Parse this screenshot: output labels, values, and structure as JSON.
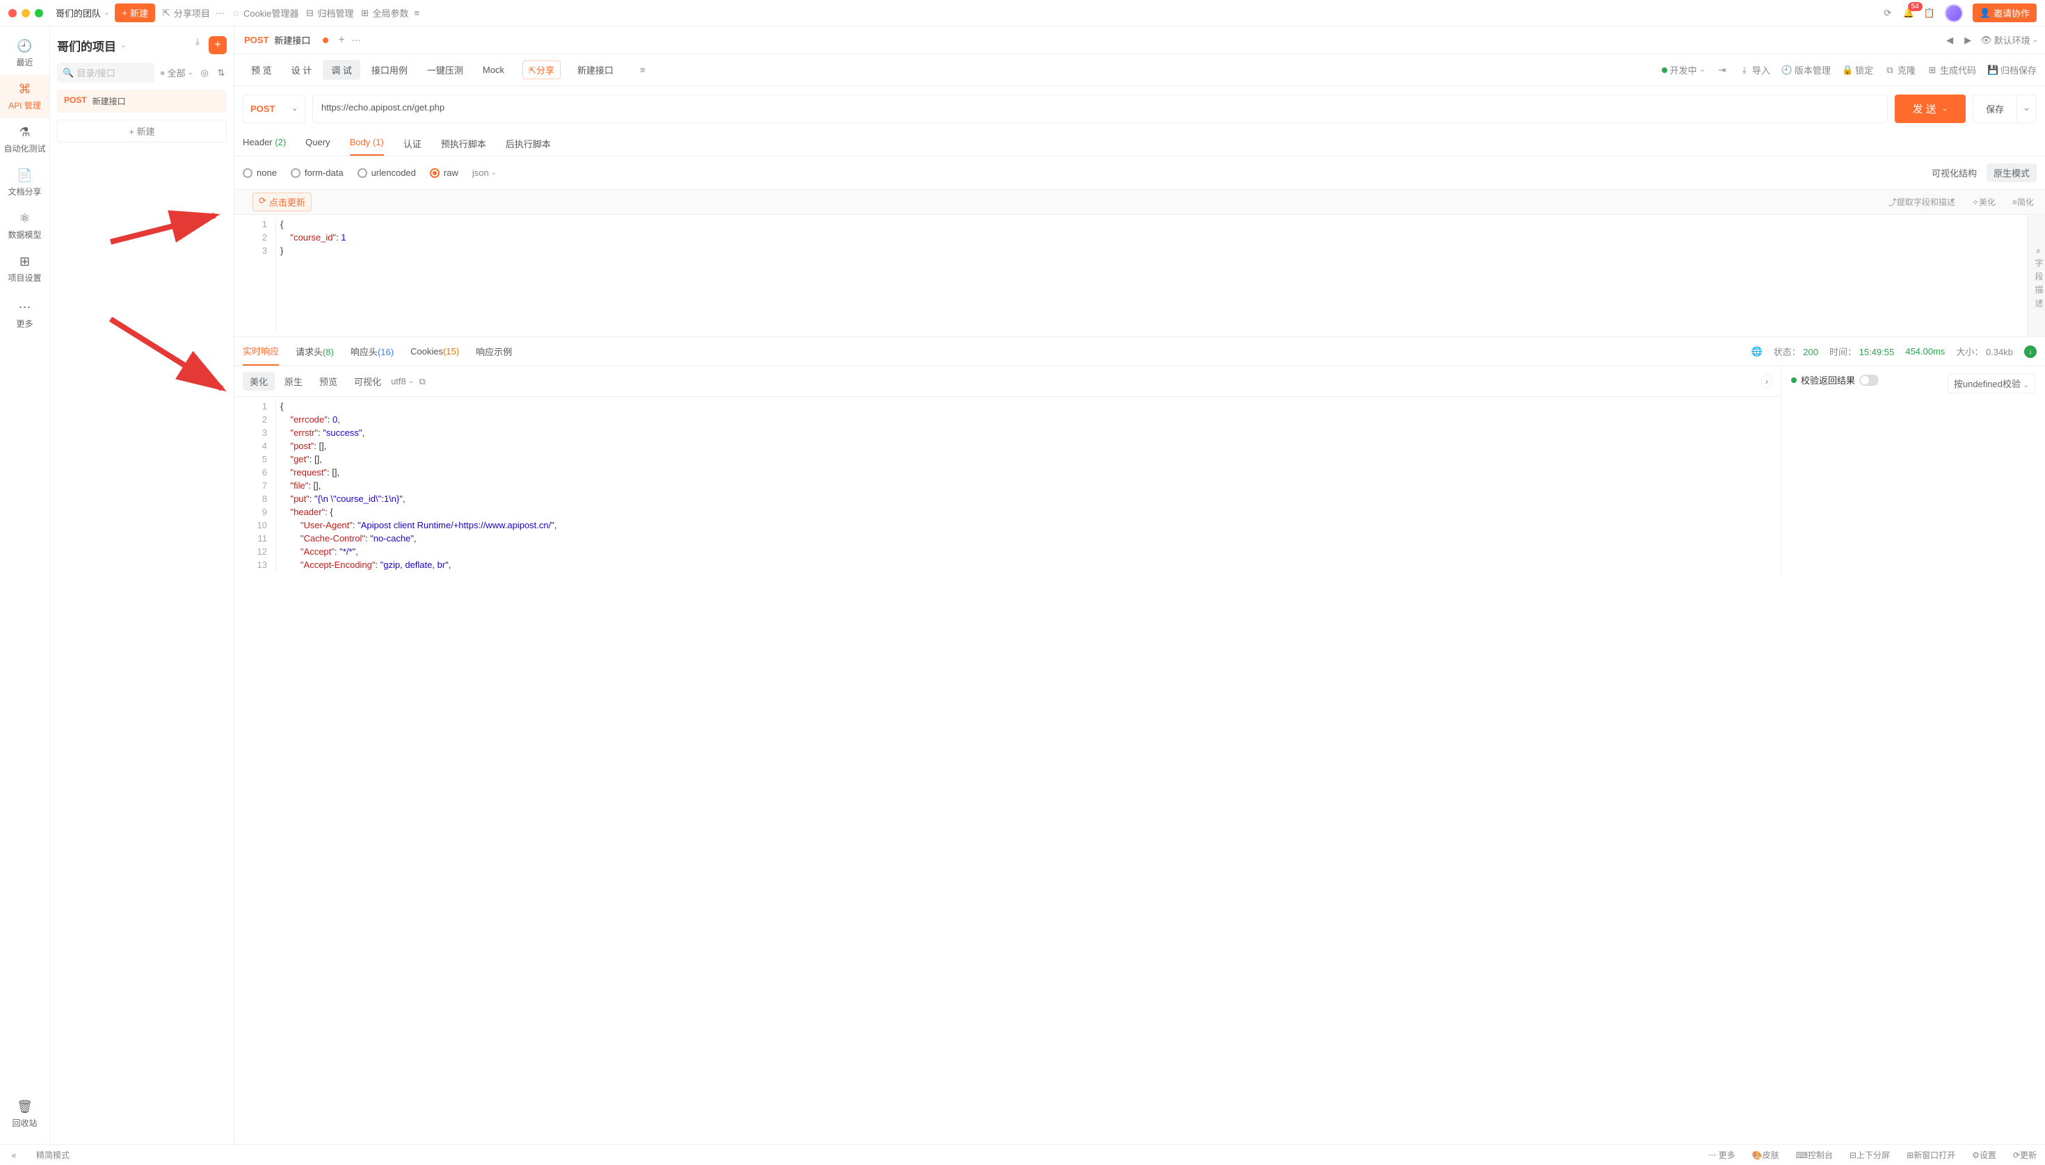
{
  "titlebar": {
    "team": "哥们的团队",
    "new": "新建",
    "share": "分享项目",
    "cookie": "Cookie管理器",
    "archive": "归档管理",
    "globals": "全局参数",
    "badge": "54",
    "invite": "邀请协作"
  },
  "rail": {
    "recent": "最近",
    "api": "API 管理",
    "autotest": "自动化测试",
    "docs": "文档分享",
    "models": "数据模型",
    "settings": "项目设置",
    "more": "更多",
    "trash": "回收站"
  },
  "sidebar": {
    "project": "哥们的项目",
    "search_ph": "目录/接口",
    "filter_all": "全部",
    "tree_method": "POST",
    "tree_name": "新建接口",
    "new_btn": "新建"
  },
  "tabs": {
    "method": "POST",
    "title": "新建接口",
    "env": "默认环境"
  },
  "toolbar": {
    "preview": "预 览",
    "design": "设 计",
    "debug": "调 试",
    "usecase": "接口用例",
    "stress": "一键压测",
    "mock": "Mock",
    "share": "分享",
    "api_name": "新建接口",
    "status": "开发中",
    "import": "导入",
    "version": "版本管理",
    "lock": "锁定",
    "clone": "克隆",
    "gencode": "生成代码",
    "archive": "归档保存"
  },
  "url": {
    "method": "POST",
    "value": "https://echo.apipost.cn/get.php",
    "send": "发 送",
    "save": "保存"
  },
  "reqtabs": {
    "header": "Header",
    "header_cnt": "(2)",
    "query": "Query",
    "body": "Body",
    "body_cnt": "(1)",
    "auth": "认证",
    "pre": "预执行脚本",
    "post": "后执行脚本"
  },
  "bodytypes": {
    "none": "none",
    "form": "form-data",
    "urlenc": "urlencoded",
    "raw": "raw",
    "json": "json",
    "visual": "可视化结构",
    "rawmode": "原生模式"
  },
  "editorhead": {
    "refresh": "点击更新",
    "extract": "提取字段和描述",
    "beautify": "美化",
    "simplify": "简化"
  },
  "reqbody": {
    "l1": "{",
    "l2key": "\"course_id\"",
    "l2val": "1",
    "l3": "}"
  },
  "sidepanel": "« 字 段 描 述",
  "resptabs": {
    "live": "实时响应",
    "reqh": "请求头",
    "reqh_cnt": "(8)",
    "resph": "响应头",
    "resph_cnt": "(16)",
    "cookies": "Cookies",
    "cookies_cnt": "(15)",
    "example": "响应示例"
  },
  "respmeta": {
    "status_lbl": "状态：",
    "status": "200",
    "time_lbl": "时间：",
    "time": "15:49:55",
    "dur": "454.00ms",
    "size_lbl": "大小：",
    "size": "0.34kb"
  },
  "resptool": {
    "beautify": "美化",
    "raw": "原生",
    "preview": "预览",
    "visual": "可视化",
    "enc": "utf8",
    "validate_lbl": "校验返回结果",
    "validate_sel": "按undefined校验"
  },
  "respcode": {
    "l1": "{",
    "l2k": "\"errcode\"",
    "l2v": "0",
    "l3k": "\"errstr\"",
    "l3v": "\"success\"",
    "l4k": "\"post\"",
    "l5k": "\"get\"",
    "l6k": "\"request\"",
    "l7k": "\"file\"",
    "l8k": "\"put\"",
    "l8v": "\"{\\n \\\"course_id\\\":1\\n}\"",
    "l9k": "\"header\"",
    "l10k": "\"User-Agent\"",
    "l10v": "\"Apipost client Runtime/+https://www.apipost.cn/\"",
    "l11k": "\"Cache-Control\"",
    "l11v": "\"no-cache\"",
    "l12k": "\"Accept\"",
    "l12v": "\"*/*\"",
    "l13k": "\"Accept-Encoding\"",
    "l13v": "\"gzip, deflate, br\""
  },
  "statusbar": {
    "mode": "精简模式",
    "more": "更多",
    "skin": "皮肤",
    "console": "控制台",
    "splitv": "上下分屏",
    "newwin": "新窗口打开",
    "settings": "设置",
    "update": "更新"
  }
}
